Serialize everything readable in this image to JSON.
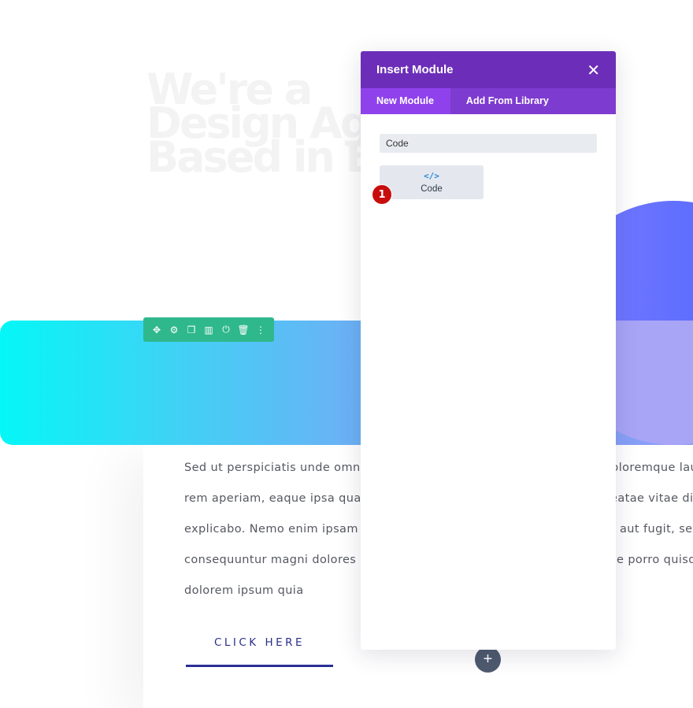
{
  "background": {
    "heading": "We're a\nDesign Ag\nBased in B",
    "paragraph_left": [
      "Sed ut perspiciatis unde omnis i",
      "rem aperiam, eaque ipsa quae a",
      "explicabo. Nemo enim ipsam vo",
      "consequuntur magni dolores eo",
      "dolorem ipsum quia"
    ],
    "paragraph_right": [
      "loloremque lau",
      "eatae vitae dic",
      "aut fugit, sed",
      "e porro quisqu"
    ],
    "button_label": "CLICK HERE",
    "add_row_symbol": "+"
  },
  "row_toolbar": {
    "icons": [
      "move-icon",
      "gear-icon",
      "duplicate-icon",
      "columns-icon",
      "power-icon",
      "trash-icon",
      "more-icon"
    ]
  },
  "modal": {
    "title": "Insert Module",
    "close_symbol": "✕",
    "tabs": [
      {
        "label": "New Module",
        "active": true
      },
      {
        "label": "Add From Library",
        "active": false
      }
    ],
    "search_value": "Code",
    "modules": [
      {
        "label": "Code",
        "icon_glyph": "</>"
      }
    ]
  },
  "annotation": {
    "step_number": "1",
    "color": "#c80d0d"
  },
  "colors": {
    "modal_header": "#6c2eb9",
    "modal_tabs": "#7e3bd0",
    "toolbar": "#2fb88c",
    "cta": "#2a2f8a"
  }
}
